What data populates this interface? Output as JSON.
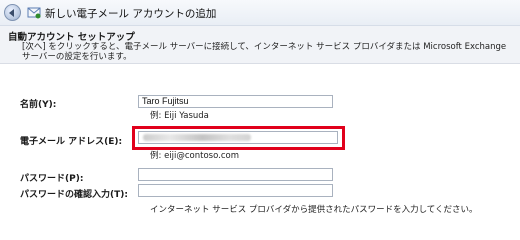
{
  "window": {
    "title": "新しい電子メール アカウントの追加"
  },
  "header": {
    "section_title": "自動アカウント セットアップ",
    "description": "[次へ] をクリックすると、電子メール サーバーに接続して、インターネット サービス プロバイダまたは Microsoft Exchange サーバーの設定を行います。"
  },
  "form": {
    "name_label": "名前(Y):",
    "name_value": "Taro Fujitsu",
    "name_hint": "例: Eiji Yasuda",
    "email_label": "電子メール アドレス(E):",
    "email_value": "",
    "email_hint": "例: eiji@contoso.com",
    "password_label": "パスワード(P):",
    "password_value": "",
    "confirm_label": "パスワードの確認入力(T):",
    "confirm_value": "",
    "password_hint": "インターネット サービス プロバイダから提供されたパスワードを入力してください。"
  },
  "colors": {
    "highlight": "#e1001b",
    "header_band": "#f1f3f7"
  },
  "icons": {
    "back": "back-arrow-icon",
    "app": "mail-account-icon"
  }
}
